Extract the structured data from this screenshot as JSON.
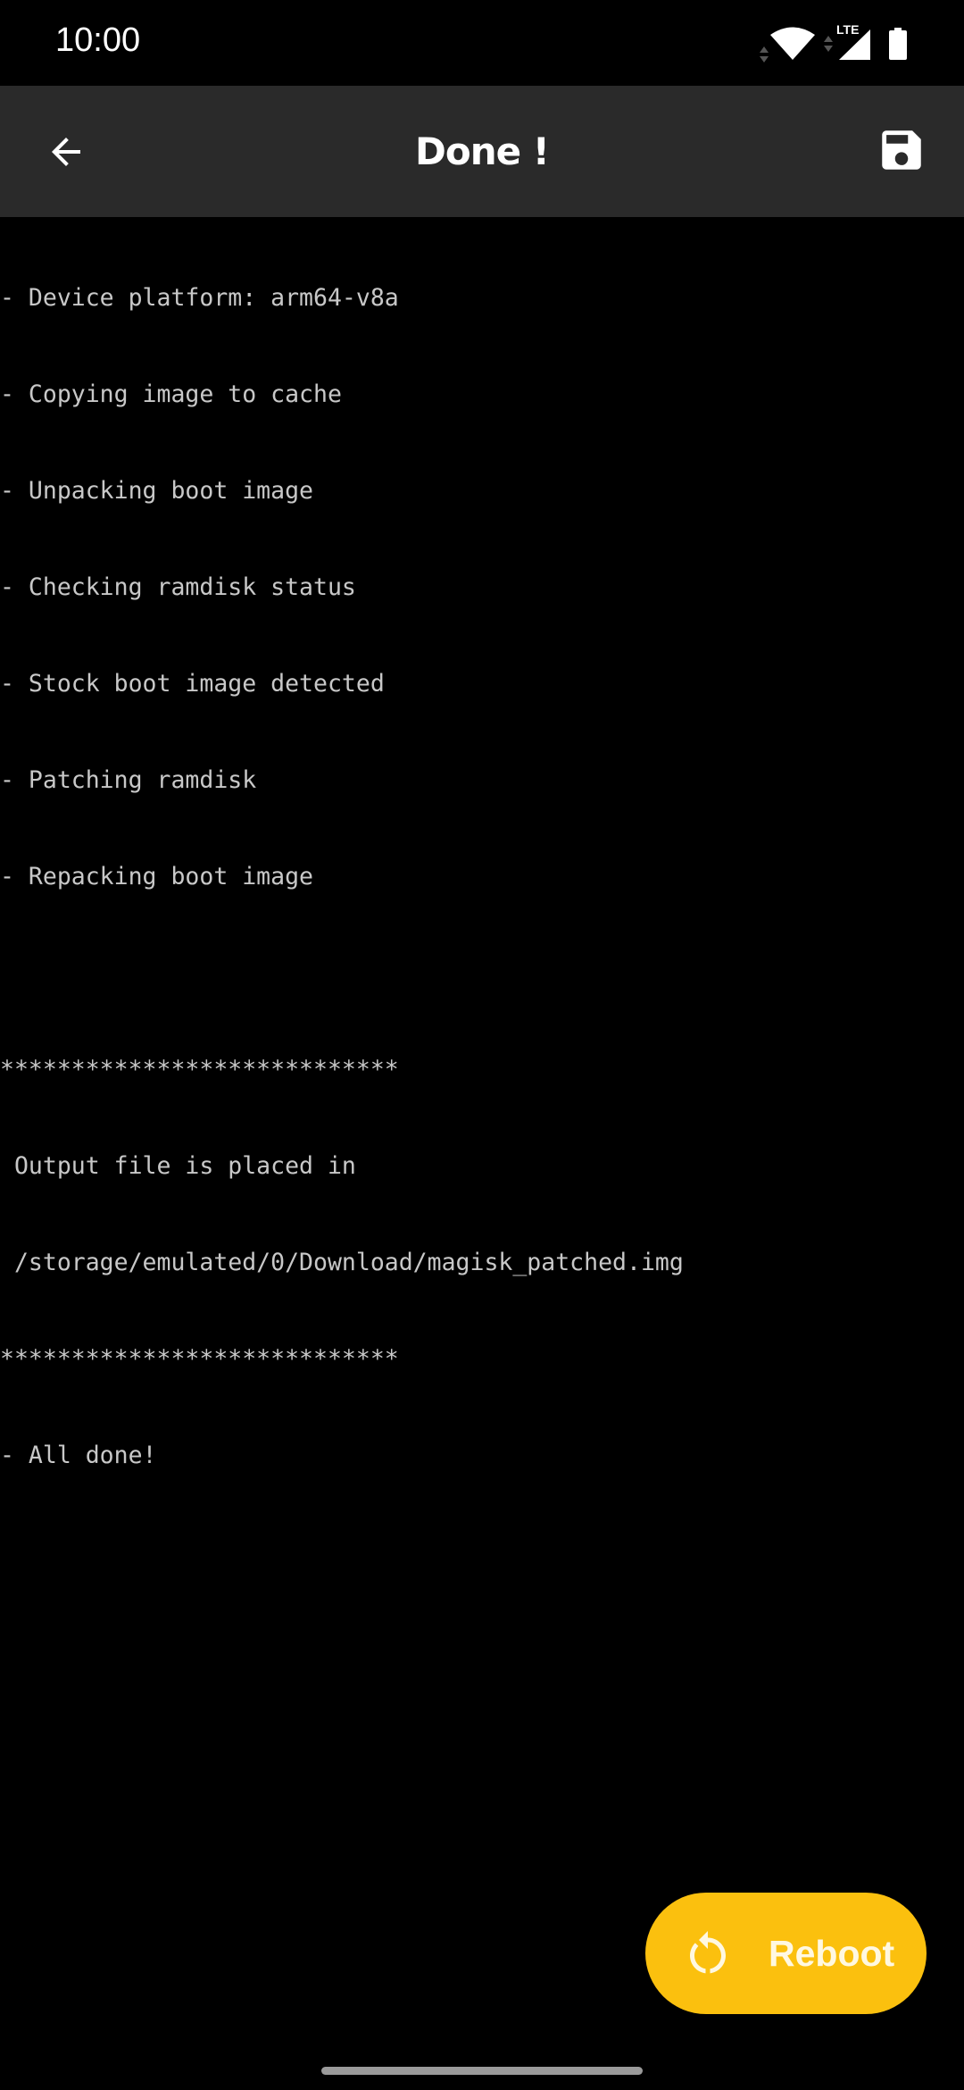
{
  "status_bar": {
    "time": "10:00",
    "network_type": "LTE",
    "icons": [
      "wifi-icon",
      "data-activity-icon",
      "cellular-signal-icon",
      "battery-icon"
    ]
  },
  "app_bar": {
    "title": "Done !",
    "back_icon": "arrow-back-icon",
    "save_icon": "save-icon"
  },
  "console": {
    "lines": [
      "- Device platform: arm64-v8a",
      "- Copying image to cache",
      "- Unpacking boot image",
      "- Checking ramdisk status",
      "- Stock boot image detected",
      "- Patching ramdisk",
      "- Repacking boot image",
      "",
      "****************************",
      " Output file is placed in",
      " /storage/emulated/0/Download/magisk_patched.img",
      "****************************",
      "- All done!"
    ],
    "text_color": "#c8c8c8"
  },
  "fab": {
    "label": "Reboot",
    "icon": "restart-icon",
    "color": "#fbc00e"
  }
}
